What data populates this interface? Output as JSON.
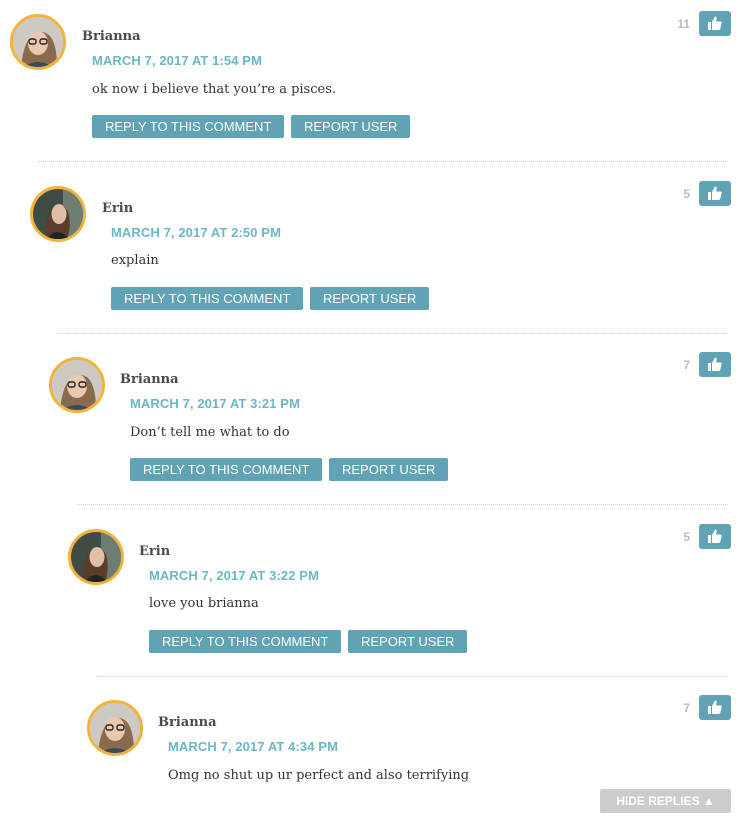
{
  "colors": {
    "accent": "#5fa3b5",
    "timestamp": "#6bb7c6",
    "avatar_border": "#f0b43c",
    "vote_count": "#b5bec2",
    "hide_button": "#cccccc"
  },
  "comments": [
    {
      "author": "Brianna",
      "timestamp": "MARCH 7, 2017 AT 1:54 PM",
      "text": "ok now i believe that you’re a pisces.",
      "votes": "11",
      "reply_label": "REPLY TO THIS COMMENT",
      "report_label": "REPORT USER",
      "like_icon": "thumbs-up-icon"
    },
    {
      "author": "Erin",
      "timestamp": "MARCH 7, 2017 AT 2:50 PM",
      "text": "explain",
      "votes": "5",
      "reply_label": "REPLY TO THIS COMMENT",
      "report_label": "REPORT USER",
      "like_icon": "thumbs-up-icon"
    },
    {
      "author": "Brianna",
      "timestamp": "MARCH 7, 2017 AT 3:21 PM",
      "text": "Don’t tell me what to do",
      "votes": "7",
      "reply_label": "REPLY TO THIS COMMENT",
      "report_label": "REPORT USER",
      "like_icon": "thumbs-up-icon"
    },
    {
      "author": "Erin",
      "timestamp": "MARCH 7, 2017 AT 3:22 PM",
      "text": "love you brianna",
      "votes": "5",
      "reply_label": "REPLY TO THIS COMMENT",
      "report_label": "REPORT USER",
      "like_icon": "thumbs-up-icon"
    },
    {
      "author": "Brianna",
      "timestamp": "MARCH 7, 2017 AT 4:34 PM",
      "text": "Omg no shut up ur perfect and also terrifying",
      "votes": "7",
      "like_icon": "thumbs-up-icon"
    }
  ],
  "hide_replies_label": "HIDE REPLIES ▲"
}
